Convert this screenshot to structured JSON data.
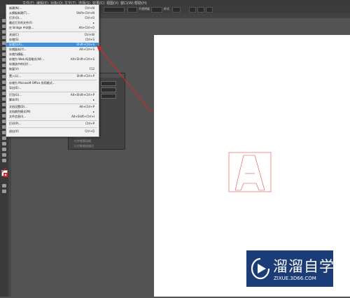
{
  "menubar": [
    "文件(F)",
    "编辑(E)",
    "对象(O)",
    "文字(T)",
    "选择(S)",
    "效果(C)",
    "视图(V)",
    "窗口(W)",
    "帮助(H)"
  ],
  "control_bar": {
    "stroke_label": "不透明度",
    "style_label": "样式"
  },
  "file_menu": {
    "items": [
      {
        "label": "新建(N)...",
        "shortcut": "Ctrl+N"
      },
      {
        "label": "从模板新建(T)...",
        "shortcut": "Shift+Ctrl+N"
      },
      {
        "label": "打开(O)...",
        "shortcut": "Ctrl+O"
      },
      {
        "label": "最近打开的文件(F)",
        "shortcut": "▸"
      },
      {
        "label": "在 Bridge 中浏览...",
        "shortcut": "Alt+Ctrl+O"
      },
      {
        "label": "关闭(C)",
        "shortcut": "Ctrl+W"
      },
      {
        "label": "存储(S)",
        "shortcut": "Ctrl+S"
      },
      {
        "label": "存储为(A)...",
        "shortcut": "Shift+Ctrl+S"
      },
      {
        "label": "存储副本(Y)...",
        "shortcut": "Alt+Ctrl+S"
      },
      {
        "label": "存储为模板...",
        "shortcut": ""
      },
      {
        "label": "存储为 Web 所用格式(W)...",
        "shortcut": "Alt+Shift+Ctrl+S"
      },
      {
        "label": "存储选中的切片...",
        "shortcut": ""
      },
      {
        "label": "恢复(V)",
        "shortcut": "F12"
      },
      {
        "label": "置入(L)...",
        "shortcut": "Shift+Ctrl+P"
      },
      {
        "label": "存储为 Microsoft Office 所用格式...",
        "shortcut": ""
      },
      {
        "label": "导出(E)...",
        "shortcut": ""
      },
      {
        "label": "打包(G)...",
        "shortcut": "Alt+Shift+Ctrl+P"
      },
      {
        "label": "脚本(R)",
        "shortcut": "▸"
      },
      {
        "label": "文档设置(D)...",
        "shortcut": "Alt+Ctrl+P"
      },
      {
        "label": "文档颜色模式(M)",
        "shortcut": "▸"
      },
      {
        "label": "文件信息(I)...",
        "shortcut": "Alt+Shift+Ctrl+I"
      },
      {
        "label": "打印(P)...",
        "shortcut": "Ctrl+P"
      },
      {
        "label": "退出(X)",
        "shortcut": "Ctrl+Q"
      }
    ]
  },
  "dialog": {
    "lines": [
      "描边对齐方式",
      "对齐像素网格",
      "以对象缩放描边"
    ]
  },
  "watermark": {
    "title": "溜溜自学",
    "url": "ZIXUE.3D66.COM"
  },
  "colors": {
    "highlight": "#3d8ee0",
    "arrow": "#cc2a2a",
    "logo_bg": "#1c3c78"
  }
}
